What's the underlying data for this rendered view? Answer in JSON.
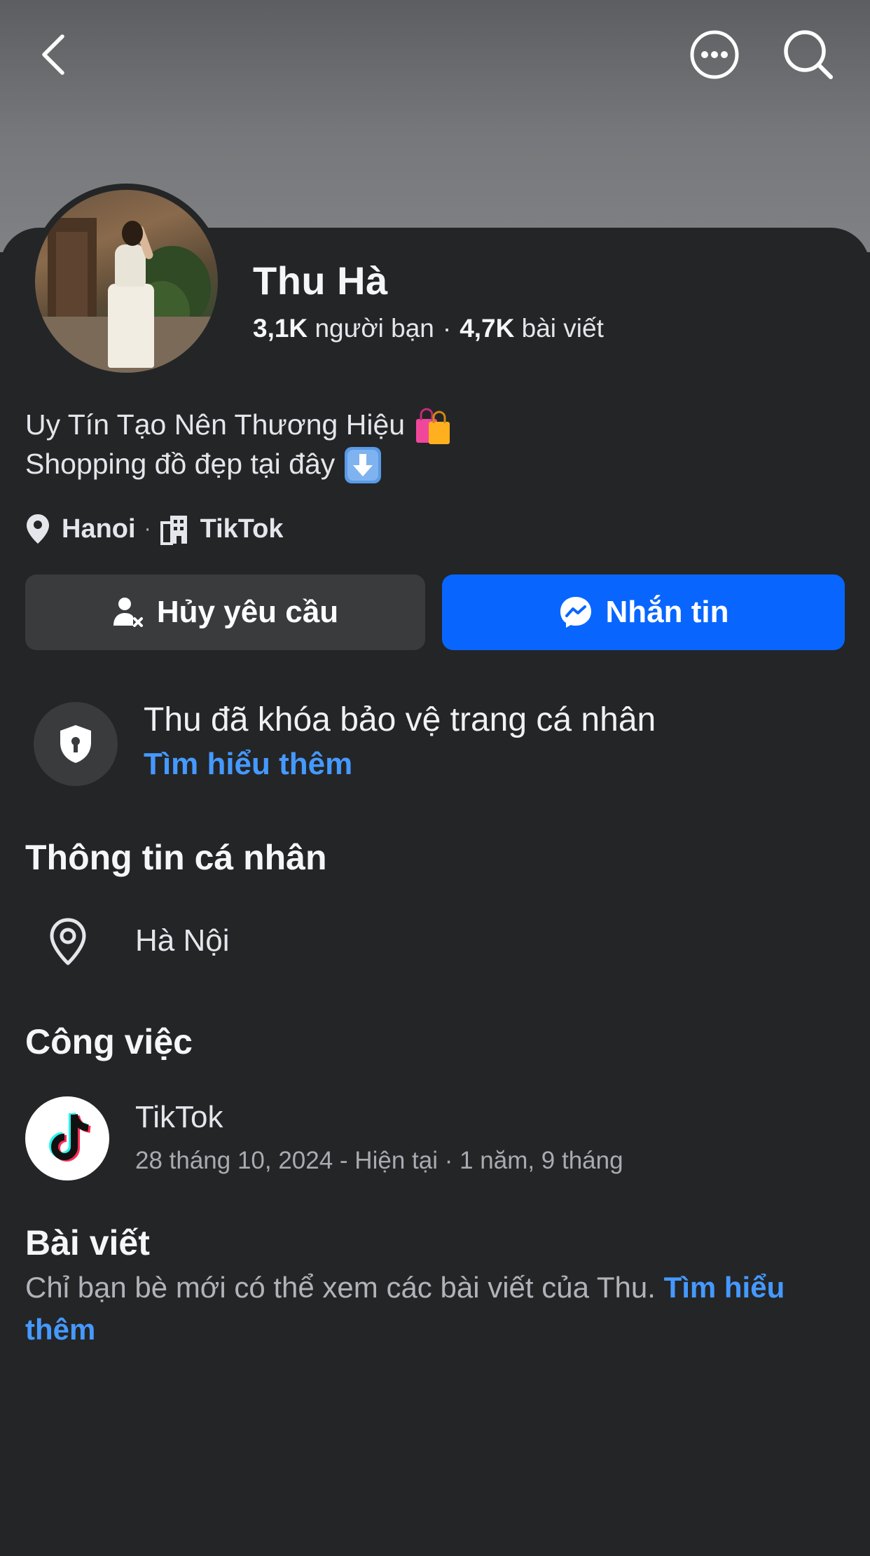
{
  "profile": {
    "name": "Thu Hà",
    "friends_count": "3,1K",
    "friends_label": "người bạn",
    "posts_count": "4,7K",
    "posts_label": "bài viết",
    "bio_line1": "Uy Tín Tạo Nên Thương Hiệu",
    "bio_line2": "Shopping đồ đẹp tại đây",
    "bio_emoji1": "shopping-bags-emoji",
    "bio_emoji2": "down-arrow-emoji",
    "location_short": "Hanoi",
    "workplace_short": "TikTok"
  },
  "actions": {
    "cancel_request": "Hủy yêu cầu",
    "message": "Nhắn tin"
  },
  "lock_notice": {
    "title": "Thu đã khóa bảo vệ trang cá nhân",
    "link": "Tìm hiểu thêm"
  },
  "personal_info": {
    "heading": "Thông tin cá nhân",
    "location": "Hà Nội"
  },
  "work": {
    "heading": "Công việc",
    "company": "TikTok",
    "period": "28 tháng 10, 2024 - Hiện tại · 1 năm, 9 tháng"
  },
  "posts": {
    "heading": "Bài viết",
    "description": "Chỉ bạn bè mới có thể xem các bài viết của Thu.",
    "link": "Tìm hiểu thêm"
  },
  "icons": {
    "back": "chevron-left-icon",
    "more": "more-icon",
    "search": "search-icon"
  },
  "colors": {
    "background": "#242527",
    "primary_button": "#0866ff",
    "secondary_button": "#3a3b3d",
    "link": "#4599ff"
  }
}
